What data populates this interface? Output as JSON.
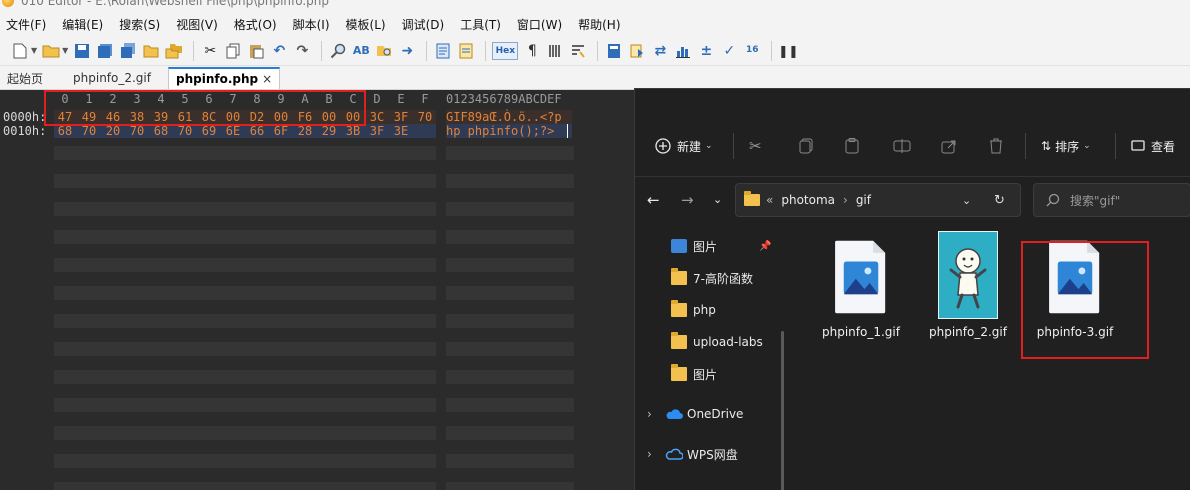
{
  "window": {
    "title": "010 Editor - E:\\Rolan\\Webshell File\\php\\phpinfo.php"
  },
  "menu": [
    "文件(F)",
    "编辑(E)",
    "搜索(S)",
    "视图(V)",
    "格式(O)",
    "脚本(I)",
    "模板(L)",
    "调试(D)",
    "工具(T)",
    "窗口(W)",
    "帮助(H)"
  ],
  "toolbar": {
    "hex_label": "Hex"
  },
  "tabs": [
    {
      "label": "起始页",
      "active": false
    },
    {
      "label": "phpinfo_2.gif",
      "active": false
    },
    {
      "label": "phpinfo.php",
      "active": true,
      "close": "×"
    }
  ],
  "hex": {
    "columns": [
      "0",
      "1",
      "2",
      "3",
      "4",
      "5",
      "6",
      "7",
      "8",
      "9",
      "A",
      "B",
      "C",
      "D",
      "E",
      "F"
    ],
    "ascii_header": "0123456789ABCDEF",
    "rows": [
      {
        "offset": "0000h:",
        "bytes": [
          "47",
          "49",
          "46",
          "38",
          "39",
          "61",
          "8C",
          "00",
          "D2",
          "00",
          "F6",
          "00",
          "00",
          "3C",
          "3F",
          "70"
        ],
        "ascii": "GIF89aŒ.Ò.ö..<?p"
      },
      {
        "offset": "0010h:",
        "bytes": [
          "68",
          "70",
          "20",
          "70",
          "68",
          "70",
          "69",
          "6E",
          "66",
          "6F",
          "28",
          "29",
          "3B",
          "3F",
          "3E"
        ],
        "ascii": "hp phpinfo();?>"
      }
    ]
  },
  "explorer": {
    "commands": {
      "new": "新建",
      "sort": "排序",
      "view": "查看"
    },
    "address": {
      "prefix": "«",
      "path": [
        "photoma",
        "gif"
      ]
    },
    "search_placeholder": "搜索\"gif\"",
    "nav_items": [
      {
        "label": "图片",
        "type": "pictures",
        "pinned": true
      },
      {
        "label": "7-高阶函数",
        "type": "folder-synced"
      },
      {
        "label": "php",
        "type": "folder"
      },
      {
        "label": "upload-labs",
        "type": "folder-synced"
      },
      {
        "label": "图片",
        "type": "folder"
      },
      {
        "label": "OneDrive",
        "type": "cloud",
        "expandable": true
      },
      {
        "label": "WPS网盘",
        "type": "cloud-wps",
        "expandable": true
      }
    ],
    "files": [
      {
        "name": "phpinfo_1.gif",
        "thumb": "image-icon"
      },
      {
        "name": "phpinfo_2.gif",
        "thumb": "cartoon"
      },
      {
        "name": "phpinfo-3.gif",
        "thumb": "image-icon",
        "highlighted": true
      }
    ]
  },
  "colors": {
    "accent": "#2c7bd6",
    "hex_text": "#e0823a",
    "highlight_box": "#e02020",
    "explorer_bg": "#202020"
  }
}
